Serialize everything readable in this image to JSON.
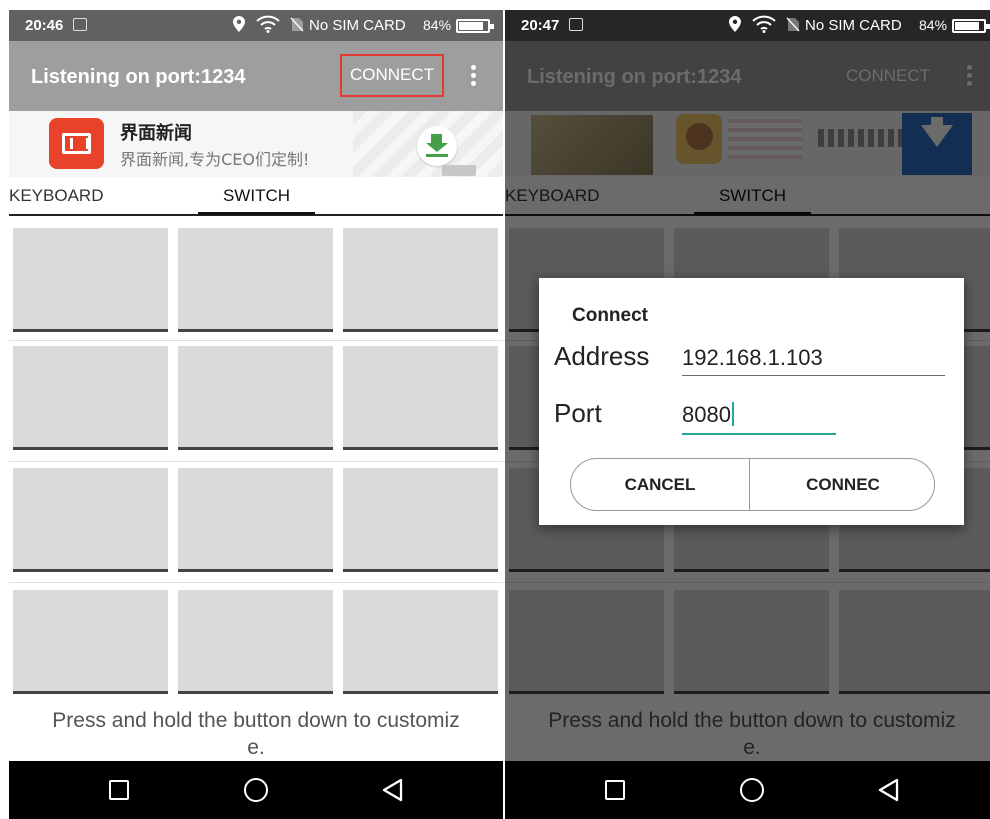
{
  "status_bar_left": {
    "time": "20:46",
    "sim": "No SIM CARD",
    "battery": "84%",
    "battery_level": 0.84
  },
  "status_bar_right": {
    "time": "20:47",
    "sim": "No SIM CARD",
    "battery": "84%",
    "battery_level": 0.84
  },
  "appbar": {
    "title": "Listening on port:1234",
    "connect_label": "CONNECT"
  },
  "ad": {
    "title": "界面新闻",
    "subtitle": "界面新闻,专为CEO们定制!"
  },
  "tabs": {
    "keyboard": "KEYBOARD",
    "switch": "SWITCH"
  },
  "grid": {
    "rows": 4,
    "columns": 3
  },
  "hint": "Press and hold the button down to customiz\ne.",
  "dialog": {
    "title": "Connect",
    "address_label": "Address",
    "address_value": "192.168.1.103",
    "port_label": "Port",
    "port_value": "8080",
    "cancel_label": "CANCEL",
    "connect_label": "CONNEC"
  },
  "colors": {
    "highlight": "#e53935",
    "accent": "#26a69a",
    "appbar": "#9e9e9e",
    "statusbar": "#616161"
  }
}
